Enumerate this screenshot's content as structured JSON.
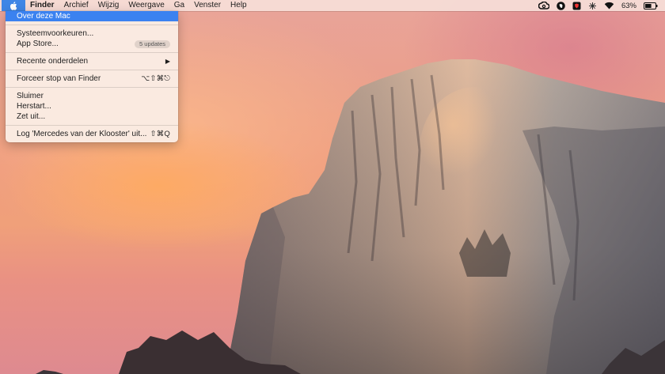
{
  "menubar": {
    "apple_icon": "apple-logo-icon",
    "items": [
      "Finder",
      "Archief",
      "Wijzig",
      "Weergave",
      "Ga",
      "Venster",
      "Help"
    ],
    "status": {
      "icons": [
        "creative-cloud-icon",
        "evernote-icon",
        "shield-icon",
        "network-icon",
        "wifi-icon",
        "battery-icon"
      ],
      "battery_percent": "63%"
    }
  },
  "apple_menu": {
    "about": "Over deze Mac",
    "system_prefs": "Systeemvoorkeuren...",
    "app_store": "App Store...",
    "app_store_badge": "5 updates",
    "recent_items": "Recente onderdelen",
    "force_quit": "Forceer stop van Finder",
    "force_quit_shortcut": "⌥⇧⌘⎋",
    "sleep": "Sluimer",
    "restart": "Herstart...",
    "shutdown": "Zet uit...",
    "logout": "Log 'Mercedes van der Klooster' uit...",
    "logout_shortcut": "⇧⌘Q"
  },
  "colors": {
    "selection": "#3b82f0",
    "menubar_bg": "#f6ded8"
  }
}
